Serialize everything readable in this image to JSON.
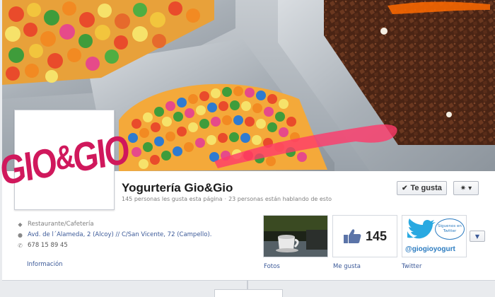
{
  "page": {
    "title": "Yogurtería Gio&Gio",
    "likes_text": "145 personas les gusta esta página",
    "separator": "·",
    "talking_text": "23 personas están hablando de esto",
    "like_button_label": "Te gusta",
    "like_button_icon": "check-icon",
    "settings_icon": "gear-icon"
  },
  "profile": {
    "logo_left": "GIO",
    "logo_amp": "&",
    "logo_right": "GIO"
  },
  "about": {
    "category": "Restaurante/Cafetería",
    "address": "Avd. de l´Alameda, 2 (Alcoy) // C/San Vicente, 72 (Campello).",
    "phone": "678 15 89 45",
    "info_link": "Información"
  },
  "tiles": {
    "photos_label": "Fotos",
    "likes_label": "Me gusta",
    "likes_count": "145",
    "twitter_label": "Twitter",
    "twitter_handle": "@giogioyogurt",
    "twitter_bubble": "Síguenos en Twitter"
  },
  "colors": {
    "link": "#3b5998",
    "brand": "#d0185c",
    "twitter": "#2b7bc0"
  }
}
